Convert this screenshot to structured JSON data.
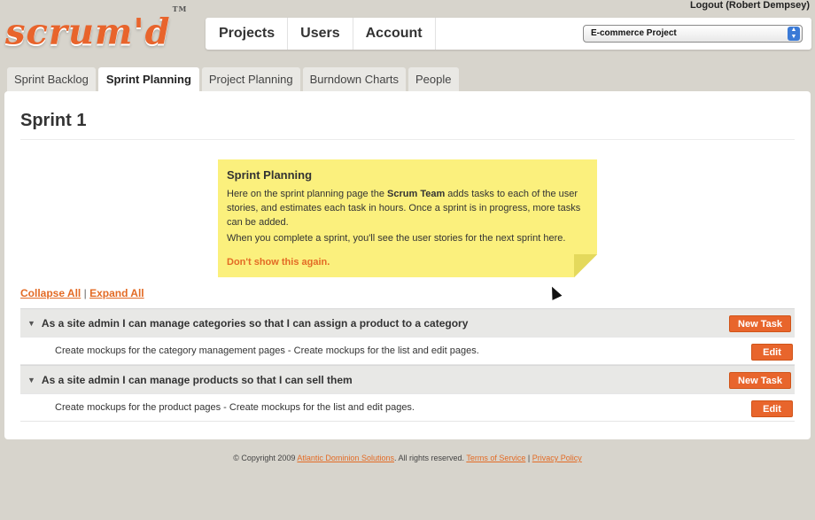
{
  "app": {
    "logo_text": "scrum'd",
    "trademark": "TM",
    "logout_label": "Logout (Robert Dempsey)"
  },
  "nav": {
    "items": [
      {
        "label": "Projects"
      },
      {
        "label": "Users"
      },
      {
        "label": "Account"
      }
    ],
    "project_select": {
      "value": "E-commerce Project"
    }
  },
  "tabs": [
    {
      "label": "Sprint Backlog",
      "active": false
    },
    {
      "label": "Sprint Planning",
      "active": true
    },
    {
      "label": "Project Planning",
      "active": false
    },
    {
      "label": "Burndown Charts",
      "active": false
    },
    {
      "label": "People",
      "active": false
    }
  ],
  "main": {
    "title": "Sprint 1",
    "note": {
      "title": "Sprint Planning",
      "p1_before": "Here on the sprint planning page the ",
      "p1_bold": "Scrum Team",
      "p1_after": " adds tasks to each of the user stories, and estimates each task in hours. Once a sprint is in progress, more tasks can be added.",
      "p2": "When you complete a sprint, you'll see the user stories for the next sprint here.",
      "dismiss": "Don't show this again."
    },
    "collapse_all": "Collapse All",
    "separator": "|",
    "expand_all": "Expand All",
    "stories": [
      {
        "title": "As a site admin I can manage categories so that I can assign a product to a category",
        "new_task_label": "New Task",
        "tasks": [
          {
            "text": "Create mockups for the category management pages - Create mockups for the list and edit pages.",
            "edit_label": "Edit"
          }
        ]
      },
      {
        "title": "As a site admin I can manage products so that I can sell them",
        "new_task_label": "New Task",
        "tasks": [
          {
            "text": "Create mockups for the product pages - Create mockups for the list and edit pages.",
            "edit_label": "Edit"
          }
        ]
      }
    ]
  },
  "footer": {
    "copyright": "© Copyright 2009",
    "company": "Atlantic Dominion Solutions",
    "rights": ". All rights reserved.",
    "terms": "Terms of Service",
    "pipe": "|",
    "privacy": "Privacy Policy"
  },
  "colors": {
    "accent": "#e8652c",
    "background": "#d7d4cc",
    "note": "#fbf07d"
  }
}
